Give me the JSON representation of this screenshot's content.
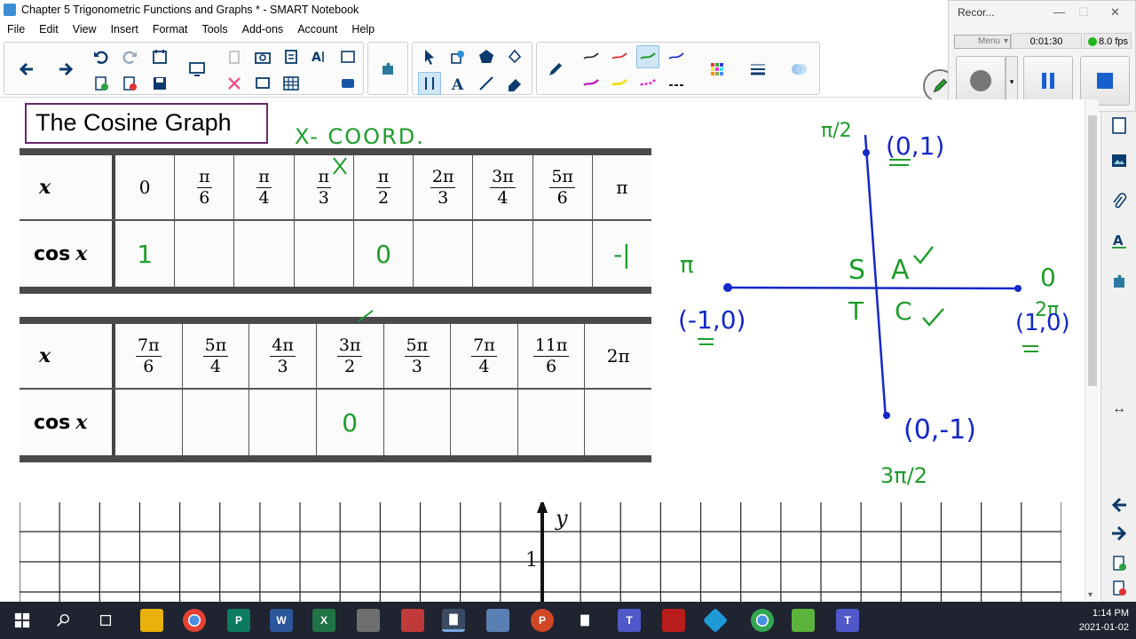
{
  "window": {
    "title": "Chapter 5 Trigonometric Functions and Graphs * - SMART Notebook"
  },
  "menu": [
    "File",
    "Edit",
    "View",
    "Insert",
    "Format",
    "Tools",
    "Add-ons",
    "Account",
    "Help"
  ],
  "recorder": {
    "title": "Recor...",
    "menu_label": "Menu",
    "elapsed": "0:01:30",
    "fps": "8.0 fps"
  },
  "page": {
    "title": "The Cosine Graph",
    "annotation": "X- COORD."
  },
  "table1": {
    "row_label": "x",
    "cos_label": "cos",
    "cos_var": "x",
    "x_values": [
      {
        "whole": "0"
      },
      {
        "num": "π",
        "den": "6"
      },
      {
        "num": "π",
        "den": "4"
      },
      {
        "num": "π",
        "den": "3"
      },
      {
        "num": "π",
        "den": "2"
      },
      {
        "num": "2π",
        "den": "3"
      },
      {
        "num": "3π",
        "den": "4"
      },
      {
        "num": "5π",
        "den": "6"
      },
      {
        "whole": "π"
      }
    ],
    "cos_values": [
      "1",
      "",
      "",
      "",
      "0",
      "",
      "",
      "",
      "-|"
    ]
  },
  "table2": {
    "row_label": "x",
    "cos_label": "cos",
    "cos_var": "x",
    "x_values": [
      {
        "num": "7π",
        "den": "6"
      },
      {
        "num": "5π",
        "den": "4"
      },
      {
        "num": "4π",
        "den": "3"
      },
      {
        "num": "3π",
        "den": "2"
      },
      {
        "num": "5π",
        "den": "3"
      },
      {
        "num": "7π",
        "den": "4"
      },
      {
        "num": "11π",
        "den": "6"
      },
      {
        "whole": "2π"
      }
    ],
    "cos_values": [
      "",
      "",
      "",
      "0",
      "",
      "",
      "",
      ""
    ]
  },
  "unit_circle": {
    "top_angle": "π/2",
    "top_point": "(0,1)",
    "left_angle": "π",
    "left_point": "(-1,0)",
    "right_angle": "0",
    "right_angle2": "2π",
    "right_point": "(1,0)",
    "bottom_point": "(0,-1)",
    "bottom_angle": "3π/2",
    "quadrant_s": "S",
    "quadrant_a": "A",
    "quadrant_t": "T",
    "quadrant_c": "C"
  },
  "graph": {
    "y_label": "y",
    "y_tick": "1"
  },
  "clock": {
    "time": "1:14 PM",
    "date": "2021-01-02"
  },
  "colors": {
    "ink_green": "#1f9d2a",
    "ink_blue": "#1428c8",
    "title_border": "#6b2a6b"
  }
}
